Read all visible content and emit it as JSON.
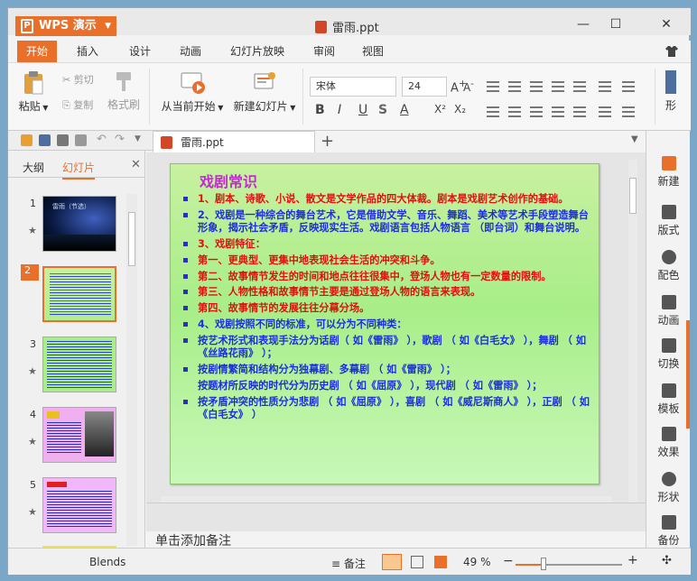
{
  "app": {
    "name": "WPS 演示",
    "doc_title": "雷雨.ppt"
  },
  "menu": [
    "开始",
    "插入",
    "设计",
    "动画",
    "幻灯片放映",
    "审阅",
    "视图"
  ],
  "ribbon": {
    "paste": "粘贴",
    "cut": "剪切",
    "copy": "复制",
    "format_painter": "格式刷",
    "play_from_current": "从当前开始",
    "new_slide": "新建幻灯片",
    "font_name": "宋体",
    "font_size": "24",
    "shape_label": "形"
  },
  "doc_tab": {
    "label": "雷雨.ppt"
  },
  "left_pane": {
    "tab_outline": "大纲",
    "tab_slides": "幻灯片",
    "slide_numbers": [
      "1",
      "2",
      "3",
      "4",
      "5"
    ],
    "thumb1_title": "雷雨（节选）"
  },
  "slide": {
    "title": "戏剧常识",
    "lines": [
      {
        "text": "1、剧本、诗歌、小说、散文是文学作品的四大体裁。剧本是戏剧艺术创作的基础。",
        "color": "red"
      },
      {
        "text": "2、戏剧是一种综合的舞台艺术，它是借助文学、音乐、舞蹈、美术等艺术手段塑造舞台形象，揭示社会矛盾，反映现实生活。戏剧语言包括人物语言 （即台词）和舞台说明。",
        "color": "blue"
      },
      {
        "text": "3、戏剧特征：",
        "color": "red"
      },
      {
        "text": "第一、更典型、更集中地表现社会生活的冲突和斗争。",
        "color": "red"
      },
      {
        "text": "第二、故事情节发生的时间和地点往往很集中，登场人物也有一定数量的限制。",
        "color": "red"
      },
      {
        "text": "第三、人物性格和故事情节主要是通过登场人物的语言来表现。",
        "color": "red"
      },
      {
        "text": "第四、故事情节的发展往往分幕分场。",
        "color": "red"
      },
      {
        "text": "4、戏剧按照不同的标准，可以分为不同种类：",
        "color": "blue"
      },
      {
        "text": "按艺术形式和表现手法分为话剧（ 如《雷雨》 ），歌剧 （ 如《白毛女》 ），舞剧 （ 如《丝路花雨》 ）；",
        "color": "blue"
      },
      {
        "text": "按剧情繁简和结构分为独幕剧、多幕剧 （ 如《雷雨》 ）；",
        "color": "blue"
      },
      {
        "text": " 按题材所反映的时代分为历史剧 （ 如《屈原》 ），现代剧 （ 如《雷雨》 ）；",
        "color": "blue",
        "nobullet": true
      },
      {
        "text": "按矛盾冲突的性质分为悲剧 （ 如《屈原》 ），喜剧 （ 如《威尼斯商人》 ），正剧 （ 如《白毛女》 ）",
        "color": "blue"
      }
    ]
  },
  "notes_placeholder": "单击添加备注",
  "right_panel": [
    "新建",
    "版式",
    "配色",
    "动画",
    "切换",
    "模板",
    "效果",
    "形状",
    "备份"
  ],
  "status": {
    "theme": "Blends",
    "notes": "备注",
    "zoom": "49 %"
  },
  "colors": {
    "accent": "#e8702a",
    "red_text": "#e01010",
    "blue_text": "#1c2ee0"
  }
}
